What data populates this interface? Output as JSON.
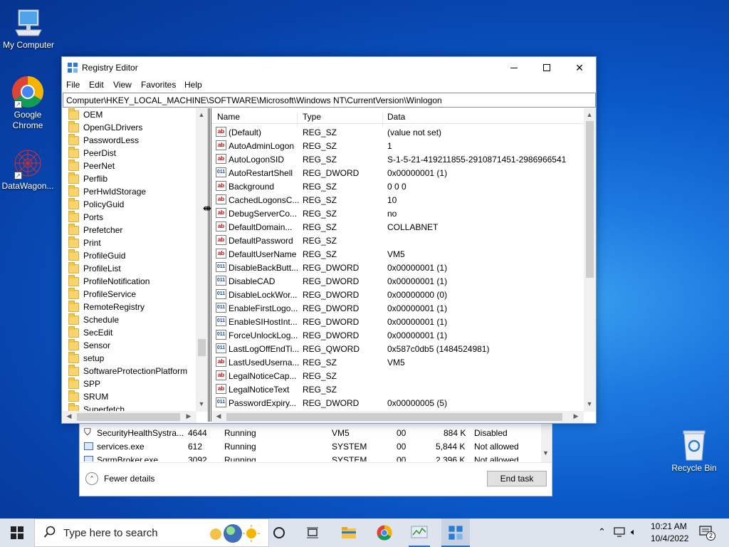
{
  "desktop": {
    "icons": [
      {
        "label": "My Computer"
      },
      {
        "label": "Google Chrome"
      },
      {
        "label": "DataWagon..."
      },
      {
        "label": "Recycle Bin"
      }
    ]
  },
  "regedit": {
    "title": "Registry Editor",
    "menu": [
      "File",
      "Edit",
      "View",
      "Favorites",
      "Help"
    ],
    "address": "Computer\\HKEY_LOCAL_MACHINE\\SOFTWARE\\Microsoft\\Windows NT\\CurrentVersion\\Winlogon",
    "tree": [
      "OEM",
      "OpenGLDrivers",
      "PasswordLess",
      "PeerDist",
      "PeerNet",
      "Perflib",
      "PerHwIdStorage",
      "PolicyGuid",
      "Ports",
      "Prefetcher",
      "Print",
      "ProfileGuid",
      "ProfileList",
      "ProfileNotification",
      "ProfileService",
      "RemoteRegistry",
      "Schedule",
      "SecEdit",
      "Sensor",
      "setup",
      "SoftwareProtectionPlatform",
      "SPP",
      "SRUM",
      "Superfetch"
    ],
    "columns": [
      "Name",
      "Type",
      "Data"
    ],
    "values": [
      {
        "name": "(Default)",
        "type": "REG_SZ",
        "data": "(value not set)",
        "icon": "string-value-icon"
      },
      {
        "name": "AutoAdminLogon",
        "type": "REG_SZ",
        "data": "1",
        "icon": "string-value-icon"
      },
      {
        "name": "AutoLogonSID",
        "type": "REG_SZ",
        "data": "S-1-5-21-419211855-2910871451-2986966541",
        "icon": "string-value-icon"
      },
      {
        "name": "AutoRestartShell",
        "type": "REG_DWORD",
        "data": "0x00000001 (1)",
        "icon": "binary-value-icon"
      },
      {
        "name": "Background",
        "type": "REG_SZ",
        "data": "0 0 0",
        "icon": "string-value-icon"
      },
      {
        "name": "CachedLogonsC...",
        "type": "REG_SZ",
        "data": "10",
        "icon": "string-value-icon"
      },
      {
        "name": "DebugServerCo...",
        "type": "REG_SZ",
        "data": "no",
        "icon": "string-value-icon"
      },
      {
        "name": "DefaultDomain...",
        "type": "REG_SZ",
        "data": "COLLABNET",
        "icon": "string-value-icon"
      },
      {
        "name": "DefaultPassword",
        "type": "REG_SZ",
        "data": "",
        "icon": "string-value-icon"
      },
      {
        "name": "DefaultUserName",
        "type": "REG_SZ",
        "data": "VM5",
        "icon": "string-value-icon"
      },
      {
        "name": "DisableBackButt...",
        "type": "REG_DWORD",
        "data": "0x00000001 (1)",
        "icon": "binary-value-icon"
      },
      {
        "name": "DisableCAD",
        "type": "REG_DWORD",
        "data": "0x00000001 (1)",
        "icon": "binary-value-icon"
      },
      {
        "name": "DisableLockWor...",
        "type": "REG_DWORD",
        "data": "0x00000000 (0)",
        "icon": "binary-value-icon"
      },
      {
        "name": "EnableFirstLogo...",
        "type": "REG_DWORD",
        "data": "0x00000001 (1)",
        "icon": "binary-value-icon"
      },
      {
        "name": "EnableSIHostInt...",
        "type": "REG_DWORD",
        "data": "0x00000001 (1)",
        "icon": "binary-value-icon"
      },
      {
        "name": "ForceUnlockLog...",
        "type": "REG_DWORD",
        "data": "0x00000001 (1)",
        "icon": "binary-value-icon"
      },
      {
        "name": "LastLogOffEndTi...",
        "type": "REG_QWORD",
        "data": "0x587c0db5 (1484524981)",
        "icon": "binary-value-icon"
      },
      {
        "name": "LastUsedUserna...",
        "type": "REG_SZ",
        "data": "VM5",
        "icon": "string-value-icon"
      },
      {
        "name": "LegalNoticeCap...",
        "type": "REG_SZ",
        "data": "",
        "icon": "string-value-icon"
      },
      {
        "name": "LegalNoticeText",
        "type": "REG_SZ",
        "data": "",
        "icon": "string-value-icon"
      },
      {
        "name": "PasswordExpiry...",
        "type": "REG_DWORD",
        "data": "0x00000005 (5)",
        "icon": "binary-value-icon"
      }
    ]
  },
  "taskmgr": {
    "rows": [
      {
        "name": "SecurityHealthSystra...",
        "pid": "4644",
        "status": "Running",
        "user": "VM5",
        "cpu": "00",
        "memory": "884 K",
        "uac": "Disabled"
      },
      {
        "name": "services.exe",
        "pid": "612",
        "status": "Running",
        "user": "SYSTEM",
        "cpu": "00",
        "memory": "5,844 K",
        "uac": "Not allowed"
      },
      {
        "name": "SgrmBroker.exe",
        "pid": "3092",
        "status": "Running",
        "user": "SYSTEM",
        "cpu": "00",
        "memory": "2,396 K",
        "uac": "Not allowed"
      }
    ],
    "fewer_details": "Fewer details",
    "end_task": "End task"
  },
  "taskbar": {
    "search_placeholder": "Type here to search",
    "time": "10:21 AM",
    "date": "10/4/2022",
    "notification_count": "2"
  }
}
